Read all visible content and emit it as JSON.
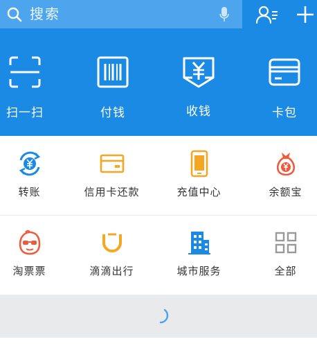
{
  "search": {
    "placeholder": "搜索"
  },
  "header_icons": [
    "search-icon",
    "microphone-icon",
    "contacts-icon",
    "plus-icon"
  ],
  "main_actions": [
    {
      "label": "扫一扫",
      "icon": "scan-icon"
    },
    {
      "label": "付钱",
      "icon": "barcode-pay-icon"
    },
    {
      "label": "收钱",
      "icon": "receive-money-icon"
    },
    {
      "label": "卡包",
      "icon": "card-wallet-icon"
    }
  ],
  "services": [
    {
      "label": "转账",
      "icon": "transfer-icon",
      "color": "#1a8ae5"
    },
    {
      "label": "信用卡还款",
      "icon": "credit-card-icon",
      "color": "#f5a623"
    },
    {
      "label": "充值中心",
      "icon": "phone-recharge-icon",
      "color": "#f5a623"
    },
    {
      "label": "余额宝",
      "icon": "money-bag-icon",
      "color": "#f05a3c"
    },
    {
      "label": "淘票票",
      "icon": "taopiaopiao-icon",
      "color": "#f05a3c"
    },
    {
      "label": "滴滴出行",
      "icon": "didi-icon",
      "color": "#f5a623"
    },
    {
      "label": "城市服务",
      "icon": "city-building-icon",
      "color": "#1a8ae5"
    },
    {
      "label": "全部",
      "icon": "grid-all-icon",
      "color": "#999999"
    }
  ],
  "colors": {
    "header_blue": "#1a8ae5",
    "search_bg": "#4da6ed",
    "loading_bg": "#e9eaec"
  }
}
